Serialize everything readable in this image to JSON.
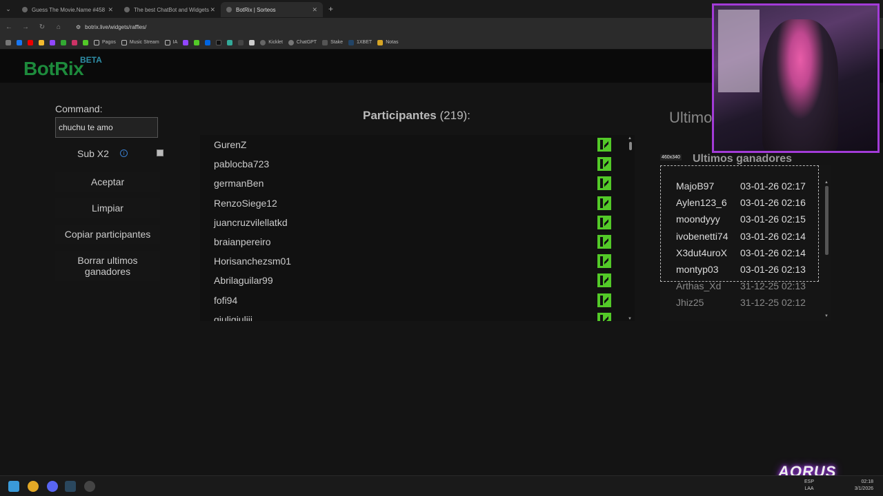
{
  "browser": {
    "tabs": [
      {
        "label": "Guess The Movie.Name #458",
        "active": false
      },
      {
        "label": "The best ChatBot and Widgets",
        "active": false
      },
      {
        "label": "BotRix | Sorteos",
        "active": true
      }
    ],
    "new_tab": "+",
    "url": "botrix.live/widgets/raffles/",
    "bookmarks": [
      "Pagos",
      "Music Stream",
      "IA",
      "Kicklet",
      "ChatGPT",
      "Stake",
      "1XBET",
      "Notas"
    ]
  },
  "header": {
    "logo": "BotRix",
    "beta": "BETA"
  },
  "left_panel": {
    "command_label": "Command:",
    "command_value": "chuchu te amo",
    "sub_label": "Sub X2",
    "info_icon": "i",
    "buttons": {
      "accept": "Aceptar",
      "clear": "Limpiar",
      "copy": "Copiar participantes",
      "delete_winners": "Borrar ultimos ganadores"
    }
  },
  "participants": {
    "title": "Participantes",
    "count": "(219):",
    "items": [
      "GurenZ",
      "pablocba723",
      "germanBen",
      "RenzoSiege12",
      "juancruzvilellatkd",
      "braianpereiro",
      "Horisanchezsm01",
      "Abrilaguilar99",
      "fofi94",
      "giuligiuliii"
    ]
  },
  "winners": {
    "partial_title": "Ultimos",
    "title": "Ultimos ganadores",
    "size_tag": "460x340",
    "items": [
      {
        "name": "MajoB97",
        "date": "03-01-26 02:17",
        "faded": false
      },
      {
        "name": "Aylen123_6",
        "date": "03-01-26 02:16",
        "faded": false
      },
      {
        "name": "moondyyy",
        "date": "03-01-26 02:15",
        "faded": false
      },
      {
        "name": "ivobenetti74",
        "date": "03-01-26 02:14",
        "faded": false
      },
      {
        "name": "X3dut4uroX",
        "date": "03-01-26 02:14",
        "faded": false
      },
      {
        "name": "montyp03",
        "date": "03-01-26 02:13",
        "faded": false
      },
      {
        "name": "Arthas_Xd",
        "date": "31-12-25 02:13",
        "faded": true
      },
      {
        "name": "Jhiz25",
        "date": "31-12-25 02:12",
        "faded": true
      }
    ]
  },
  "overlay": {
    "brand": "AORUS"
  },
  "taskbar": {
    "lang": "ESP",
    "lang_sub": "LAA",
    "time": "02:18",
    "date": "3/1/2026"
  },
  "colors": {
    "logo": "#1d8a3c",
    "kick": "#53c928",
    "webcam_border": "#a33bd8"
  }
}
